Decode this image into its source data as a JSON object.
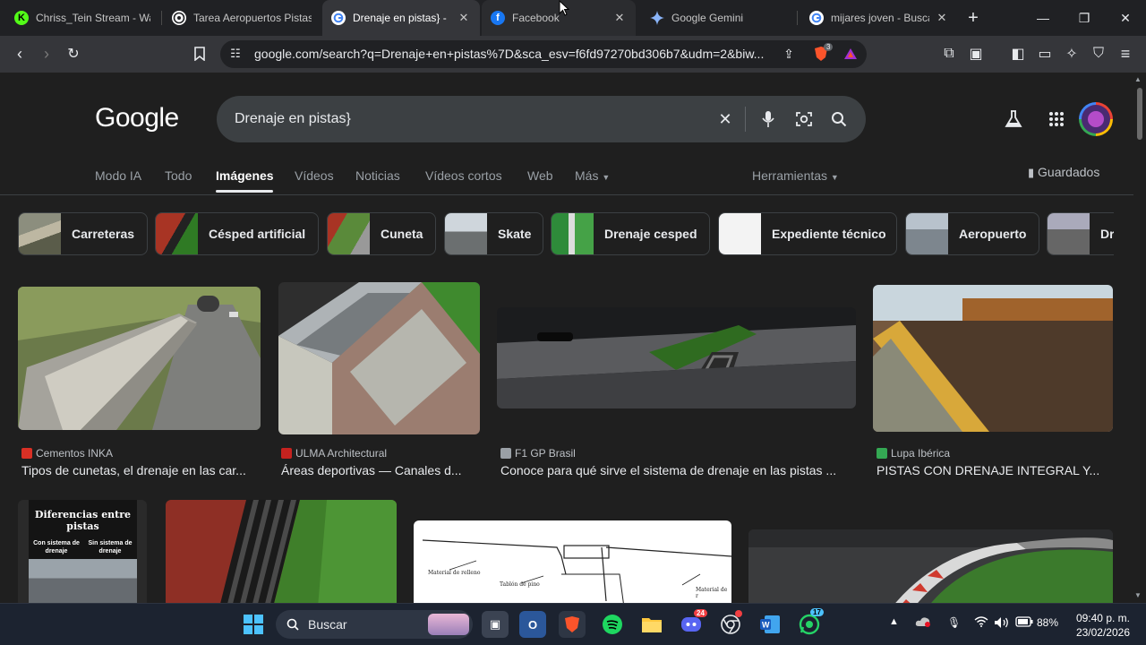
{
  "tabs": [
    {
      "title": "Chriss_Tein Stream - Wa",
      "favicon": "kick-icon",
      "color": "#53fc18",
      "closable": false
    },
    {
      "title": "Tarea Aeropuertos Pistas",
      "favicon": "chatgpt-icon",
      "color": "#e8eaed",
      "closable": false
    },
    {
      "title": "Drenaje en pistas} -",
      "favicon": "google-icon",
      "color": "#ffffff",
      "closable": true,
      "active": true
    },
    {
      "title": "Facebook",
      "favicon": "facebook-icon",
      "color": "#1877f2",
      "closable": true
    },
    {
      "title": "Google Gemini",
      "favicon": "gemini-icon",
      "color": "#8ab4f8",
      "closable": false
    },
    {
      "title": "mijares joven - Buscar c",
      "favicon": "google-icon",
      "color": "#ffffff",
      "closable": true
    }
  ],
  "address_bar": {
    "url": "google.com/search?q=Drenaje+en+pistas%7D&sca_esv=f6fd97270bd306b7&udm=2&biw..."
  },
  "brave_badge": "3",
  "google": {
    "logo": "Google",
    "query": "Drenaje en pistas}",
    "nav": [
      "Modo IA",
      "Todo",
      "Imágenes",
      "Vídeos",
      "Noticias",
      "Vídeos cortos",
      "Web",
      "Más"
    ],
    "active_nav": "Imágenes",
    "tools": "Herramientas",
    "saved": "Guardados"
  },
  "chips": [
    "Carreteras",
    "Césped artificial",
    "Cuneta",
    "Skate",
    "Drenaje cesped",
    "Expediente técnico",
    "Aeropuerto",
    "Dr"
  ],
  "results": [
    {
      "source": "Cementos INKA",
      "caption": "Tipos de cunetas, el drenaje en las car...",
      "src_color": "#d93025"
    },
    {
      "source": "ULMA Architectural",
      "caption": "Áreas deportivas — Canales d...",
      "src_color": "#c5221f"
    },
    {
      "source": "F1 GP Brasil",
      "caption": "Conoce para qué sirve el sistema de drenaje en las pistas ...",
      "src_color": "#9aa0a6"
    },
    {
      "source": "Lupa Ibérica",
      "caption": "PISTAS CON DRENAJE INTEGRAL Y...",
      "src_color": "#34a853"
    }
  ],
  "second_row": {
    "poster_title": "Diferencias entre pistas",
    "poster_left": "Con sistema de drenaje",
    "poster_right": "Sin sistema de drenaje",
    "diagram_label_1": "Material de relleno",
    "diagram_label_2": "Tablón de pino",
    "diagram_label_3": "Material de r"
  },
  "taskbar": {
    "search": "Buscar",
    "badge_discord": "24",
    "badge_whatsapp": "17",
    "battery": "88%",
    "time": "09:40 p. m.",
    "date": "23/02/2026"
  }
}
